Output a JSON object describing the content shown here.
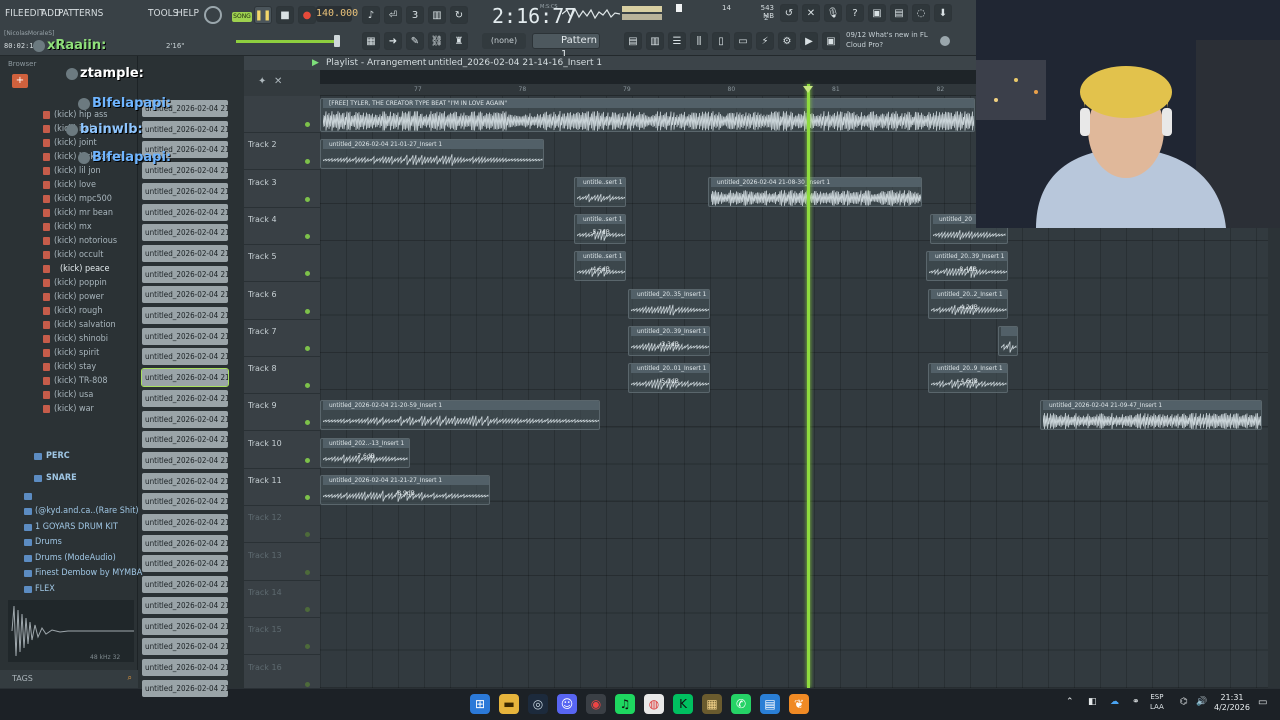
{
  "menu": [
    "FILE",
    "EDIT",
    "ADD",
    "PATTERNS",
    "TOOLS",
    "HELP"
  ],
  "transport": {
    "mode_label": "SONG",
    "tempo": "140.000",
    "time": "2:16:77",
    "time_unit": "M:S:CS"
  },
  "status": {
    "cpu": "14",
    "memory": "543 MB",
    "memory_sub": "2",
    "hint_user": "[NicolasMoraleS]",
    "time_code": "80:02:13",
    "hint_value": "2'16\""
  },
  "pattern": {
    "snap": "(none)",
    "name": "Pattern 1"
  },
  "news": {
    "line1": "09/12  What's new in FL",
    "line2": "Cloud Pro?"
  },
  "browser": {
    "title": "Browser",
    "kicks": [
      "(kick) hip ass",
      "(kick) italy",
      "(kick) joint",
      "(kick) kickboxing",
      "(kick) lil jon",
      "(kick) love",
      "(kick) mpc500",
      "(kick) mr bean",
      "(kick) mx",
      "(kick) notorious",
      "(kick) occult",
      "(kick) peace",
      "(kick) poppin",
      "(kick) power",
      "(kick) rough",
      "(kick) salvation",
      "(kick) shinobi",
      "(kick) spirit",
      "(kick) stay",
      "(kick) TR-808",
      "(kick) usa",
      "(kick) war"
    ],
    "folders": [
      "PERC",
      "SNARE"
    ],
    "packs": [
      "(@kyd.and.ca..(Rare Shit)",
      "1 GOYARS DRUM KIT",
      "Drums",
      "Drums (ModeAudio)",
      "Finest Dembow by MYMBA",
      "FLEX"
    ],
    "sample_info": "48 kHz 32",
    "tags_label": "TAGS"
  },
  "clips_column": {
    "label": "untitled_2026-02-04 21-"
  },
  "playlist": {
    "title": "Playlist - Arrangement",
    "breadcrumb": "untitled_2026-02-04 21-14-16_Insert 1",
    "ruler": [
      {
        "label": "77",
        "pos": 0
      },
      {
        "label": "78",
        "pos": 1
      },
      {
        "label": "79",
        "pos": 2
      },
      {
        "label": "80",
        "pos": 3
      },
      {
        "label": "81",
        "pos": 4
      },
      {
        "label": "82",
        "pos": 5
      }
    ],
    "tracks": [
      "",
      "Track 2",
      "Track 3",
      "Track 4",
      "Track 5",
      "Track 6",
      "Track 7",
      "Track 8",
      "Track 9",
      "Track 10",
      "Track 11",
      "Track 12",
      "Track 13",
      "Track 14",
      "Track 15",
      "Track 16"
    ],
    "clips": [
      {
        "track": 0,
        "start": 0,
        "len": 655,
        "title": "[FREE] TYLER, THE CREATOR TYPE BEAT \"I'M IN LOVE AGAIN\"",
        "db": "",
        "dense": true
      },
      {
        "track": 1,
        "start": 0,
        "len": 224,
        "title": "untitled_2026-02-04 21-01-27_Insert 1",
        "db": ""
      },
      {
        "track": 2,
        "start": 254,
        "len": 52,
        "title": "untitle..sert 1",
        "db": ""
      },
      {
        "track": 2,
        "start": 388,
        "len": 214,
        "title": "untitled_2026-02-04 21-08-30_Insert 1",
        "db": "",
        "dense": true
      },
      {
        "track": 3,
        "start": 254,
        "len": 52,
        "title": "untitle..sert 1",
        "db": "-5.7dB"
      },
      {
        "track": 3,
        "start": 610,
        "len": 78,
        "title": "untitled_20",
        "db": ""
      },
      {
        "track": 4,
        "start": 254,
        "len": 52,
        "title": "untitle..sert 1",
        "db": "-4.6dB"
      },
      {
        "track": 4,
        "start": 606,
        "len": 82,
        "title": "untitled_20..39_Insert 1",
        "db": "-8.4dB"
      },
      {
        "track": 5,
        "start": 308,
        "len": 82,
        "title": "untitled_20..35_Insert 1",
        "db": ""
      },
      {
        "track": 5,
        "start": 608,
        "len": 80,
        "title": "untitled_20..2_Insert 1",
        "db": "-4.2dB"
      },
      {
        "track": 6,
        "start": 308,
        "len": 82,
        "title": "untitled_20..39_Insert 1",
        "db": "-3.3dB"
      },
      {
        "track": 6,
        "start": 678,
        "len": 20,
        "title": "",
        "db": ""
      },
      {
        "track": 7,
        "start": 308,
        "len": 82,
        "title": "untitled_20..01_Insert 1",
        "db": "-5.1dB"
      },
      {
        "track": 7,
        "start": 608,
        "len": 80,
        "title": "untitled_20..9_Insert 1",
        "db": "-4.6dB"
      },
      {
        "track": 8,
        "start": 0,
        "len": 280,
        "title": "untitled_2026-02-04 21-20-59_Insert 1",
        "db": ""
      },
      {
        "track": 8,
        "start": 720,
        "len": 222,
        "title": "untitled_2026-02-04 21-09-47_Insert 1",
        "db": "",
        "dense": true
      },
      {
        "track": 9,
        "start": 0,
        "len": 90,
        "title": "untitled_202..-13_Insert 1",
        "db": "-7.6dB"
      },
      {
        "track": 10,
        "start": 0,
        "len": 170,
        "title": "untitled_2026-02-04 21-21-27_Insert 1",
        "db": "-8.9dB"
      }
    ]
  },
  "chat": [
    {
      "name": "ztample:",
      "color": "#ffffff"
    },
    {
      "name": "xRaaiin:",
      "color": "#8fe07a"
    },
    {
      "name": "Blfelapapi:",
      "color": "#6fb5ff"
    },
    {
      "name": "bainwlb:",
      "color": "#8fc6ff"
    },
    {
      "name": "Blfelapapi:",
      "color": "#6fb5ff"
    }
  ],
  "tray": {
    "lang": "ESP",
    "region": "LAA",
    "time": "21:31",
    "date": "4/2/2026"
  }
}
